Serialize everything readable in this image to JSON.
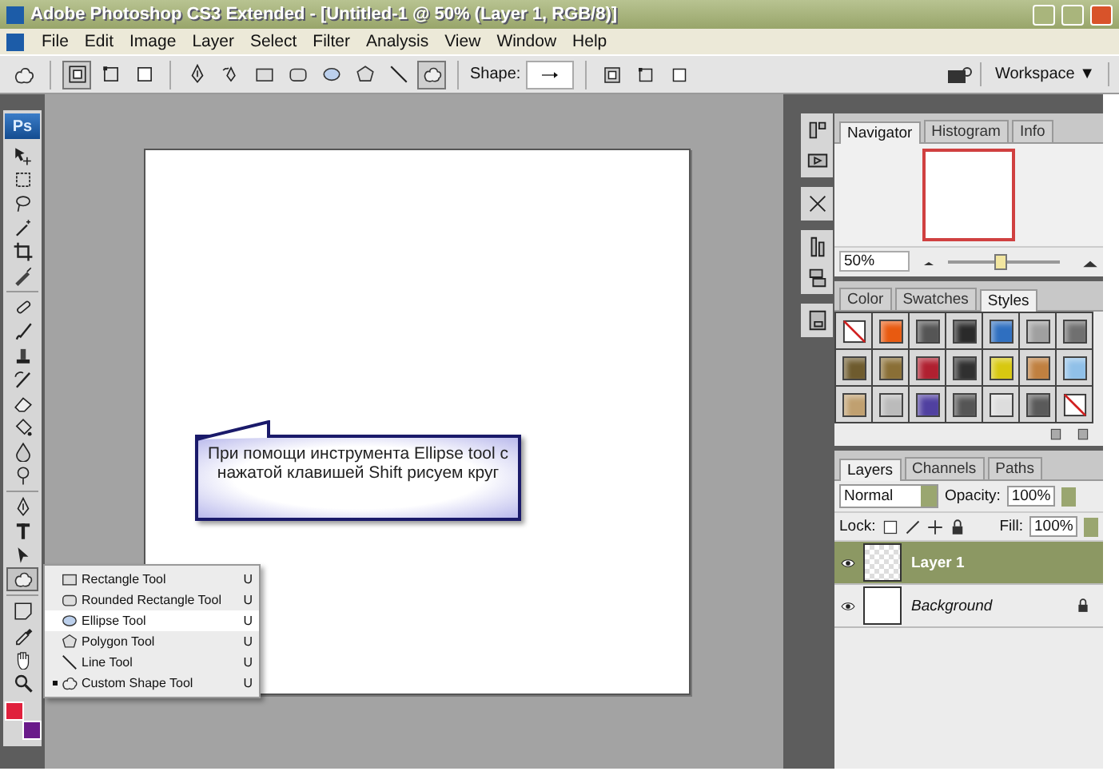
{
  "window": {
    "title": "Adobe Photoshop CS3 Extended - [Untitled-1 @ 50% (Layer 1, RGB/8)]"
  },
  "menu": [
    "File",
    "Edit",
    "Image",
    "Layer",
    "Select",
    "Filter",
    "Analysis",
    "View",
    "Window",
    "Help"
  ],
  "options_bar": {
    "mode_buttons": [
      {
        "kind": "shape-layer",
        "selected": true
      },
      {
        "kind": "paths",
        "selected": false
      },
      {
        "kind": "fill-pixels",
        "selected": false
      }
    ],
    "tool_buttons": [
      {
        "kind": "pen",
        "selected": false
      },
      {
        "kind": "freeform-pen",
        "selected": false
      },
      {
        "kind": "rectangle",
        "selected": false
      },
      {
        "kind": "rounded-rectangle",
        "selected": false
      },
      {
        "kind": "ellipse",
        "selected": false
      },
      {
        "kind": "polygon",
        "selected": false
      },
      {
        "kind": "line",
        "selected": false
      },
      {
        "kind": "custom-shape",
        "selected": true
      }
    ],
    "shape_label": "Shape:",
    "workspace": "Workspace ▼"
  },
  "toolbox": {
    "logo": "Ps",
    "tools": [
      {
        "kind": "move",
        "selected": false
      },
      {
        "kind": "marquee",
        "selected": false
      },
      {
        "kind": "lasso",
        "selected": false
      },
      {
        "kind": "wand",
        "selected": false
      },
      {
        "kind": "crop",
        "selected": false
      },
      {
        "kind": "slice",
        "selected": false
      },
      {
        "kind": "heal",
        "selected": false
      },
      {
        "kind": "brush",
        "selected": false
      },
      {
        "kind": "stamp",
        "selected": false
      },
      {
        "kind": "history-brush",
        "selected": false
      },
      {
        "kind": "eraser",
        "selected": false
      },
      {
        "kind": "bucket",
        "selected": false
      },
      {
        "kind": "blur",
        "selected": false
      },
      {
        "kind": "dodge",
        "selected": false
      },
      {
        "kind": "pen",
        "selected": false
      },
      {
        "kind": "type",
        "selected": false
      },
      {
        "kind": "path-select",
        "selected": false
      },
      {
        "kind": "custom-shape",
        "selected": true
      },
      {
        "kind": "notes",
        "selected": false
      },
      {
        "kind": "eyedropper",
        "selected": false
      },
      {
        "kind": "hand",
        "selected": false
      },
      {
        "kind": "zoom",
        "selected": false
      }
    ],
    "colors": [
      {
        "kind": "foreground",
        "color": "#e0203c"
      },
      {
        "kind": "background",
        "color": "#6a1a8a"
      }
    ]
  },
  "shape_flyout": [
    {
      "kind": "rectangle",
      "label": "Rectangle Tool",
      "shortcut": "U",
      "selected": false,
      "current": false
    },
    {
      "kind": "rounded-rectangle",
      "label": "Rounded Rectangle Tool",
      "shortcut": "U",
      "selected": false,
      "current": false
    },
    {
      "kind": "ellipse",
      "label": "Ellipse Tool",
      "shortcut": "U",
      "selected": true,
      "current": false
    },
    {
      "kind": "polygon",
      "label": "Polygon Tool",
      "shortcut": "U",
      "selected": false,
      "current": false
    },
    {
      "kind": "line",
      "label": "Line Tool",
      "shortcut": "U",
      "selected": false,
      "current": false
    },
    {
      "kind": "custom-shape",
      "label": "Custom Shape Tool",
      "shortcut": "U",
      "selected": false,
      "current": true
    }
  ],
  "callout": {
    "text": "При помощи инструмента Ellipse tool с нажатой клавишей Shift рисуем круг"
  },
  "navigator": {
    "tabs": [
      {
        "label": "Navigator",
        "selected": true
      },
      {
        "label": "Histogram",
        "selected": false
      },
      {
        "label": "Info",
        "selected": false
      }
    ],
    "zoom": "50%",
    "level": 0.45
  },
  "styles": {
    "tabs": [
      {
        "label": "Color",
        "selected": false
      },
      {
        "label": "Swatches",
        "selected": false
      },
      {
        "label": "Styles",
        "selected": true
      }
    ],
    "swatches": [
      {
        "kind": "none"
      },
      {
        "kind": "fill",
        "color": "#e85a10"
      },
      {
        "kind": "fill",
        "color": "#555555"
      },
      {
        "kind": "fill",
        "color": "#2a2a2a"
      },
      {
        "kind": "fill",
        "color": "#2f6fc0"
      },
      {
        "kind": "fill",
        "color": "#a0a0a0"
      },
      {
        "kind": "fill",
        "color": "#707070"
      },
      {
        "kind": "fill",
        "color": "#6e5b2e"
      },
      {
        "kind": "fill",
        "color": "#8a6f36"
      },
      {
        "kind": "fill",
        "color": "#b02030"
      },
      {
        "kind": "fill",
        "color": "#303030"
      },
      {
        "kind": "fill",
        "color": "#d8c810"
      },
      {
        "kind": "fill",
        "color": "#c08040"
      },
      {
        "kind": "fill",
        "color": "#90c0e8"
      },
      {
        "kind": "fill",
        "color": "#c0a070"
      },
      {
        "kind": "fill",
        "color": "#bbbbbb"
      },
      {
        "kind": "fill",
        "color": "#5040a0"
      },
      {
        "kind": "fill",
        "color": "#555555"
      },
      {
        "kind": "fill",
        "color": "#dddddd"
      },
      {
        "kind": "fill",
        "color": "#5a5a5a"
      },
      {
        "kind": "none"
      }
    ]
  },
  "layers_panel": {
    "tabs": [
      {
        "label": "Layers",
        "selected": true
      },
      {
        "label": "Channels",
        "selected": false
      },
      {
        "label": "Paths",
        "selected": false
      }
    ],
    "blend_mode": "Normal",
    "opacity_label": "Opacity:",
    "opacity": "100%",
    "lock_label": "Lock:",
    "fill_label": "Fill:",
    "fill": "100%",
    "layers": [
      {
        "name": "Layer 1",
        "selected": true,
        "visible": true,
        "locked": false,
        "transparent": true
      },
      {
        "name": "Background",
        "selected": false,
        "visible": true,
        "locked": true,
        "transparent": false
      }
    ]
  }
}
